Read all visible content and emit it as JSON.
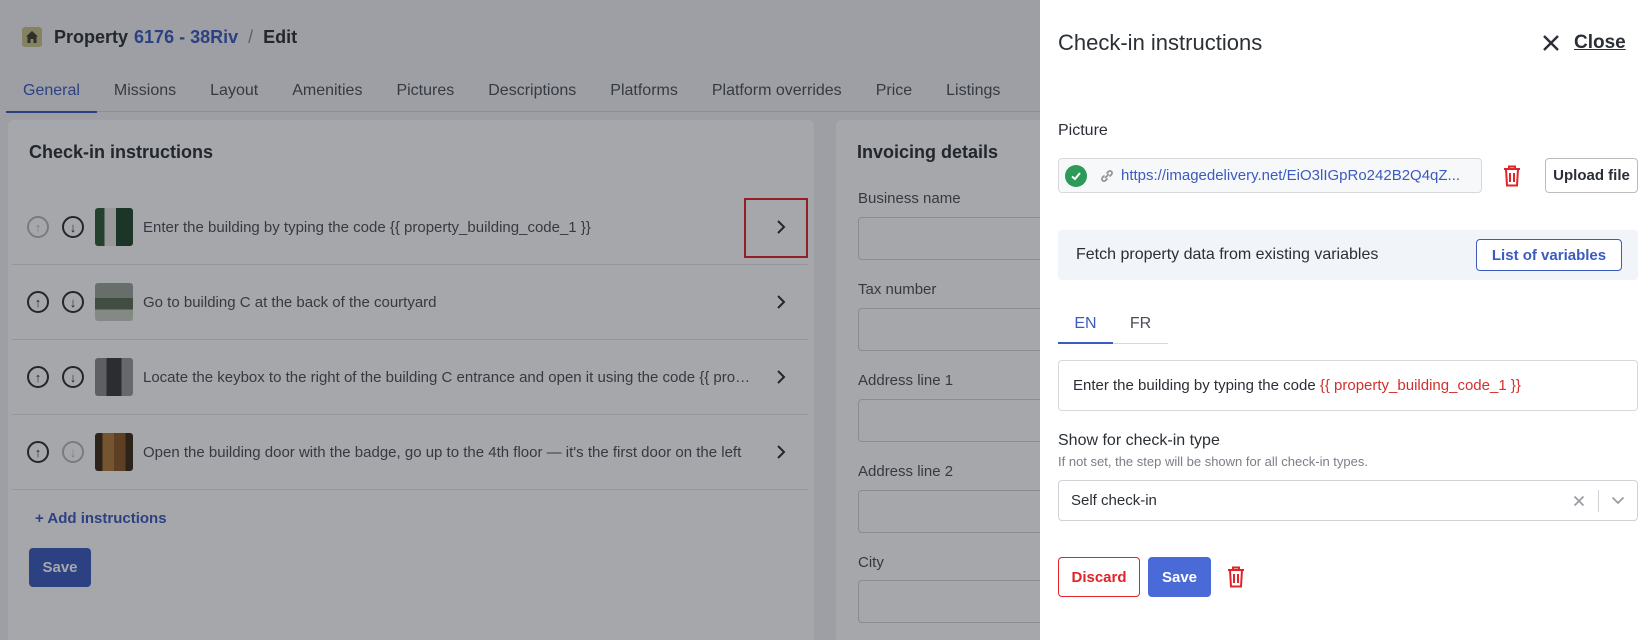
{
  "header": {
    "prefix": "Property",
    "property_link": "6176 - 38Riv",
    "separator": "/",
    "current": "Edit"
  },
  "tabs": [
    {
      "label": "General",
      "active": true
    },
    {
      "label": "Missions"
    },
    {
      "label": "Layout"
    },
    {
      "label": "Amenities"
    },
    {
      "label": "Pictures"
    },
    {
      "label": "Descriptions"
    },
    {
      "label": "Platforms"
    },
    {
      "label": "Platform overrides"
    },
    {
      "label": "Price"
    },
    {
      "label": "Listings"
    }
  ],
  "checkin_card": {
    "title": "Check-in instructions",
    "steps": [
      {
        "text": "Enter the building by typing the code {{ property_building_code_1 }}",
        "up_disabled": true,
        "down_disabled": false
      },
      {
        "text": "Go to building C at the back of the courtyard",
        "up_disabled": false,
        "down_disabled": false
      },
      {
        "text": "Locate the keybox to the right of the building C entrance and open it using the code {{ property_keybox_code }}",
        "up_disabled": false,
        "down_disabled": false
      },
      {
        "text": "Open the building door with the badge, go up to the 4th floor — it's the first door on the left",
        "up_disabled": false,
        "down_disabled": true
      }
    ],
    "add_label": "+ Add instructions",
    "save_label": "Save"
  },
  "invoicing_card": {
    "title": "Invoicing details",
    "fields": [
      "Business name",
      "Tax number",
      "Address line 1",
      "Address line 2",
      "City"
    ]
  },
  "drawer": {
    "title": "Check-in instructions",
    "close_label": "Close",
    "picture_label": "Picture",
    "picture_url": "https://imagedelivery.net/EiO3lIGpRo242B2Q4qZ...",
    "upload_label": "Upload file",
    "fetch_text": "Fetch property data from existing variables",
    "variables_button": "List of variables",
    "languages": [
      {
        "label": "EN",
        "active": true
      },
      {
        "label": "FR"
      }
    ],
    "instruction_text": "Enter the building by typing the code ",
    "instruction_variable": "{{ property_building_code_1 }}",
    "checkin_type_label": "Show for check-in type",
    "checkin_type_help": "If not set, the step will be shown for all check-in types.",
    "checkin_type_value": "Self check-in",
    "discard_label": "Discard",
    "save_label": "Save"
  },
  "colors": {
    "accent": "#3b5bbf",
    "danger": "#e0242a",
    "success": "#2d9a5a"
  }
}
